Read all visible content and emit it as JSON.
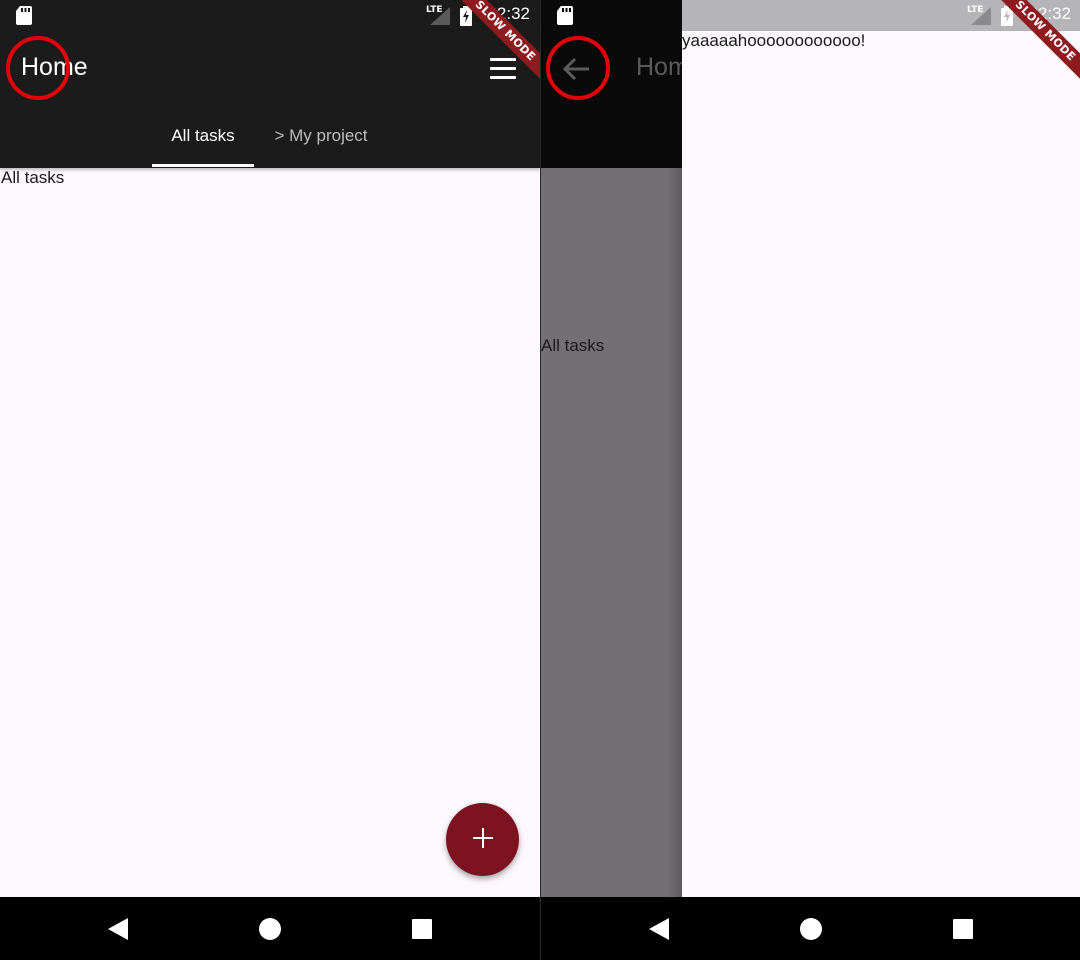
{
  "left_screen": {
    "status_bar": {
      "time": "22:32",
      "network": "LTE",
      "icons": [
        "sd-card-icon",
        "signal-icon",
        "battery-charging-icon"
      ]
    },
    "debug_banner": "SLOW MODE",
    "app_bar": {
      "title": "Home",
      "menu_icon": "hamburger-menu-icon"
    },
    "tabs": [
      {
        "label": "All tasks",
        "selected": true
      },
      {
        "label": "> My project",
        "selected": false
      }
    ],
    "body": {
      "text": "All tasks"
    },
    "fab": {
      "icon": "plus-icon",
      "color": "#7d1320"
    },
    "nav_bar": {
      "buttons": [
        "back-triangle-icon",
        "home-circle-icon",
        "recents-square-icon"
      ]
    },
    "annotation": {
      "color": "#e3000b"
    }
  },
  "right_screen": {
    "status_bar": {
      "time": "22:32",
      "network": "LTE",
      "icons": [
        "sd-card-icon",
        "signal-icon",
        "battery-charging-icon"
      ]
    },
    "debug_banner": "SLOW MODE",
    "app_bar": {
      "title": "Home",
      "back_icon": "arrow-back-icon"
    },
    "underlying_text": "All tasks",
    "page": {
      "text": "yaaaaahoooooooooooo!"
    },
    "nav_bar": {
      "buttons": [
        "back-triangle-icon",
        "home-circle-icon",
        "recents-square-icon"
      ]
    },
    "annotation": {
      "color": "#e3000b"
    }
  },
  "colors": {
    "app_bar": "#1b1b1b",
    "surface": "#fdf8fc",
    "accent": "#7d1320",
    "scrim": "#737073"
  }
}
